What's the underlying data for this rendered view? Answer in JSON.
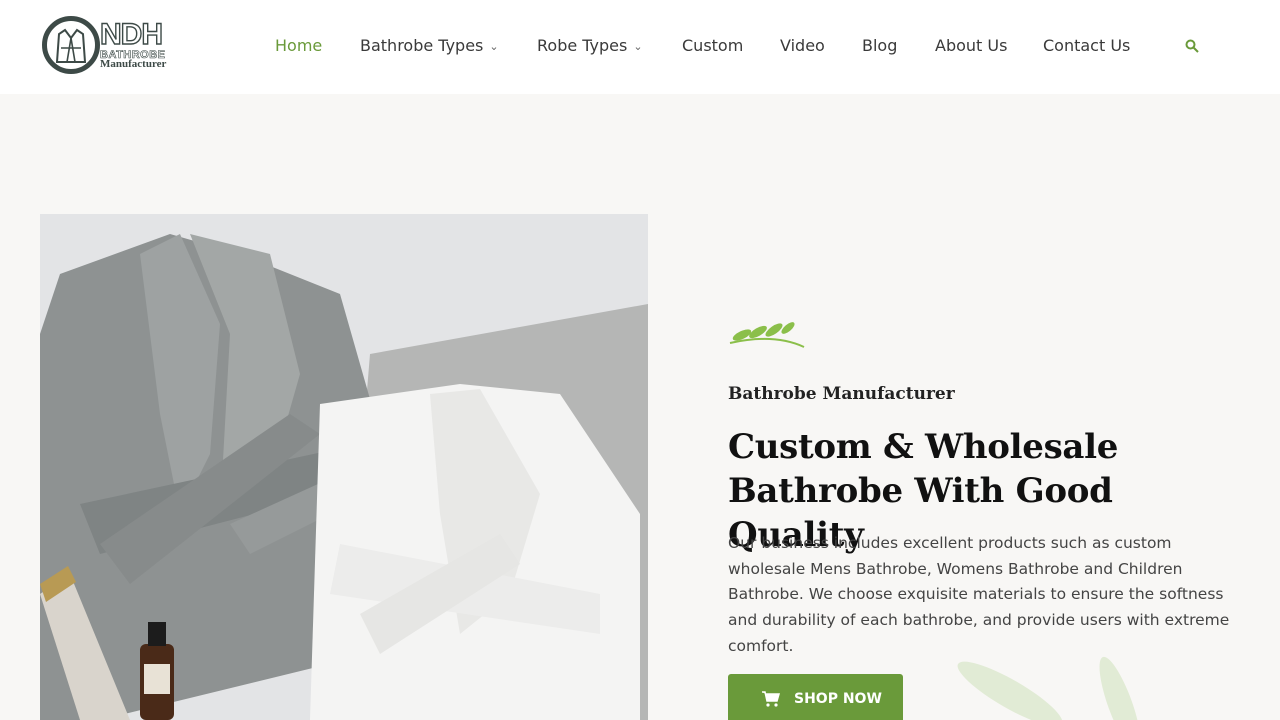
{
  "logo": {
    "main": "NDH",
    "line1": "BATHROBE",
    "line2": "Manufacturer"
  },
  "nav": {
    "items": [
      {
        "label": "Home",
        "active": true
      },
      {
        "label": "Bathrobe Types",
        "dropdown": true
      },
      {
        "label": "Robe Types",
        "dropdown": true
      },
      {
        "label": "Custom"
      },
      {
        "label": "Video"
      },
      {
        "label": "Blog"
      },
      {
        "label": "About Us"
      },
      {
        "label": "Contact Us"
      }
    ],
    "search_icon": "search-icon"
  },
  "hero": {
    "eyebrow": "Bathrobe Manufacturer",
    "title": "Custom & Wholesale Bathrobe With Good Quality",
    "description": "Our business includes excellent products such as custom wholesale Mens Bathrobe, Womens Bathrobe and Children Bathrobe. We choose exquisite materials to ensure the softness and durability of each bathrobe, and provide users with extreme comfort.",
    "cta_label": "SHOP NOW",
    "cta_icon": "cart-icon"
  },
  "colors": {
    "accent": "#6a9a3a",
    "hero_bg": "#f8f7f5",
    "logo_dark": "#3d4a47"
  }
}
